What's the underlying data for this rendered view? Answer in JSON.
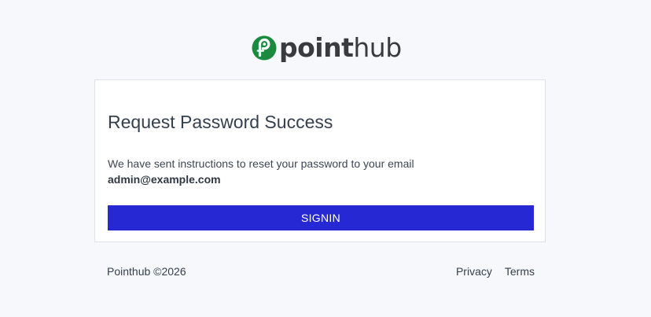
{
  "brand": {
    "logo_bold": "point",
    "logo_light": "hub",
    "logo_color": "#1a8a3f",
    "icon": "pointhub-logo-icon"
  },
  "card": {
    "title": "Request Password Success",
    "message": "We have sent instructions to reset your password to your email",
    "email": "admin@example.com",
    "button_label": "SIGNIN",
    "button_color": "#2628d3"
  },
  "footer": {
    "copyright": "Pointhub ©2026",
    "links": [
      "Privacy",
      "Terms"
    ]
  }
}
